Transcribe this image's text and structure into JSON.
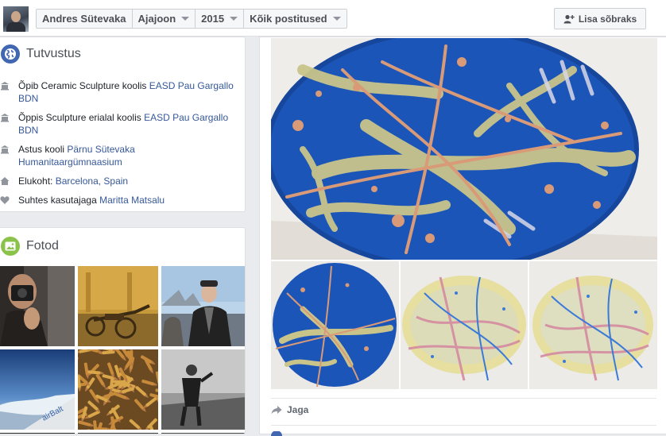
{
  "header": {
    "crumbs": [
      "Andres Sütevaka",
      "Ajajoon",
      "2015",
      "Kõik postitused"
    ],
    "add_friend_label": "Lisa sõbraks"
  },
  "intro": {
    "title": "Tutvustus",
    "items": [
      {
        "icon": "school-icon",
        "text": "Õpib Ceramic Sculpture koolis ",
        "link": "EASD Pau Gargallo BDN"
      },
      {
        "icon": "school-icon",
        "text": "Õppis Sculpture erialal koolis ",
        "link": "EASD Pau Gargallo BDN"
      },
      {
        "icon": "school-icon",
        "text": "Astus kooli ",
        "link": "Pärnu Sütevaka Humanitaargümnaasium"
      },
      {
        "icon": "home-icon",
        "text": "Elukoht: ",
        "link": "Barcelona, Spain"
      },
      {
        "icon": "heart-icon",
        "text": "Suhtes kasutajaga ",
        "link": "Maritta Matsalu"
      }
    ]
  },
  "photos": {
    "title": "Fotod"
  },
  "post": {
    "share_label": "Jaga"
  },
  "colors": {
    "link": "#365899",
    "globe_icon_bg": "#4267b2",
    "photos_icon_bg": "#8bc34a"
  }
}
